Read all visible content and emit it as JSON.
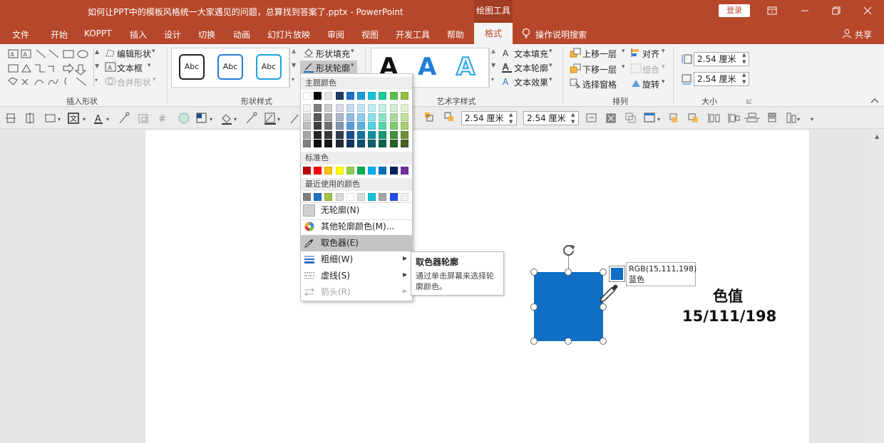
{
  "window": {
    "title": "如何让PPT中的模板风格统一大家遇见的问题，总算找到答案了.pptx  -  PowerPoint",
    "context_label": "绘图工具",
    "login": "登录"
  },
  "tabs": [
    "文件",
    "开始",
    "KOPPT",
    "插入",
    "设计",
    "切换",
    "动画",
    "幻灯片放映",
    "审阅",
    "视图",
    "开发工具",
    "帮助"
  ],
  "active_tab": "格式",
  "tell_me": "操作说明搜索",
  "share": "共享",
  "ribbon": {
    "insert_shapes": {
      "label": "插入形状",
      "edit_shape": "编辑形状",
      "text_box": "文本框",
      "merge_shapes": "合并形状"
    },
    "shape_styles": {
      "label": "形状样式",
      "preview_text": "Abc",
      "fill": "形状填充",
      "outline": "形状轮廓"
    },
    "wordart": {
      "label": "艺术字样式",
      "glyph": "A",
      "text_fill": "文本填充",
      "text_outline": "文本轮廓",
      "text_effects": "文本效果"
    },
    "arrange": {
      "label": "排列",
      "bring_forward": "上移一层",
      "send_backward": "下移一层",
      "selection_pane": "选择窗格",
      "align": "对齐",
      "group": "组合",
      "rotate": "旋转"
    },
    "size": {
      "label": "大小",
      "height": "2.54 厘米",
      "width": "2.54 厘米"
    }
  },
  "toolbar2": {
    "height": "2.54 厘米",
    "width": "2.54 厘米"
  },
  "outline_menu": {
    "theme_header": "主题颜色",
    "standard_header": "标准色",
    "recent_header": "最近使用的颜色",
    "theme_top": [
      "#ffffff",
      "#000000",
      "#e7e6e6",
      "#1f3864",
      "#1f6fc5",
      "#1e9ad6",
      "#16c1d5",
      "#20c99c",
      "#5cc050",
      "#8fbe4b"
    ],
    "theme_shades": [
      [
        "#f2f2f2",
        "#7f7f7f",
        "#d0cece",
        "#d6dce4",
        "#c7dcf2",
        "#c4e4f4",
        "#c2eef3",
        "#c4f1e3",
        "#d4ecd1",
        "#e1efd0"
      ],
      [
        "#d8d8d8",
        "#595959",
        "#aeaaaa",
        "#adb9ca",
        "#92bbe6",
        "#8ecbea",
        "#8ae0e9",
        "#8ae4c9",
        "#abdba3",
        "#c4df9f"
      ],
      [
        "#bfbfbf",
        "#3f3f3f",
        "#757070",
        "#8497b0",
        "#5e9ad9",
        "#59b2e0",
        "#52d2e0",
        "#52d6ae",
        "#80ca74",
        "#a6cf70"
      ],
      [
        "#a5a5a5",
        "#262626",
        "#3a3838",
        "#323f4f",
        "#174f93",
        "#1573a0",
        "#10909f",
        "#159674",
        "#44903c",
        "#6b8f38"
      ],
      [
        "#7f7f7f",
        "#0c0c0c",
        "#171616",
        "#222a35",
        "#0f3462",
        "#0e4d6b",
        "#0b606a",
        "#0e644d",
        "#2d6028",
        "#475f25"
      ]
    ],
    "standard": [
      "#c00000",
      "#ff0000",
      "#ffc000",
      "#ffff00",
      "#92d050",
      "#00b050",
      "#00b0f0",
      "#0070c0",
      "#002060",
      "#7030a0"
    ],
    "recent": [
      "#7f7f7f",
      "#1f6fc5",
      "#a5c249",
      "#d9d9d9",
      "#ffffff",
      "#d9d9d9",
      "#16c1d5",
      "#a5a5a5",
      "#1f4de6",
      "#f2f2f2"
    ],
    "no_outline": "无轮廓(N)",
    "more_colors": "其他轮廓颜色(M)...",
    "eyedropper": "取色器(E)",
    "weight": "粗细(W)",
    "dashes": "虚线(S)",
    "arrows": "箭头(R)"
  },
  "tooltip": {
    "title": "取色器轮廓",
    "body": "通过单击屏幕来选择轮廓颜色。"
  },
  "rgb_tip": {
    "value": "RGB(15,111,198)",
    "name": "蓝色"
  },
  "slide": {
    "label_title": "色值",
    "label_value": "15/111/198"
  },
  "colors": {
    "accent": "#b7472a",
    "shape_fill": "#0f6fc6"
  }
}
